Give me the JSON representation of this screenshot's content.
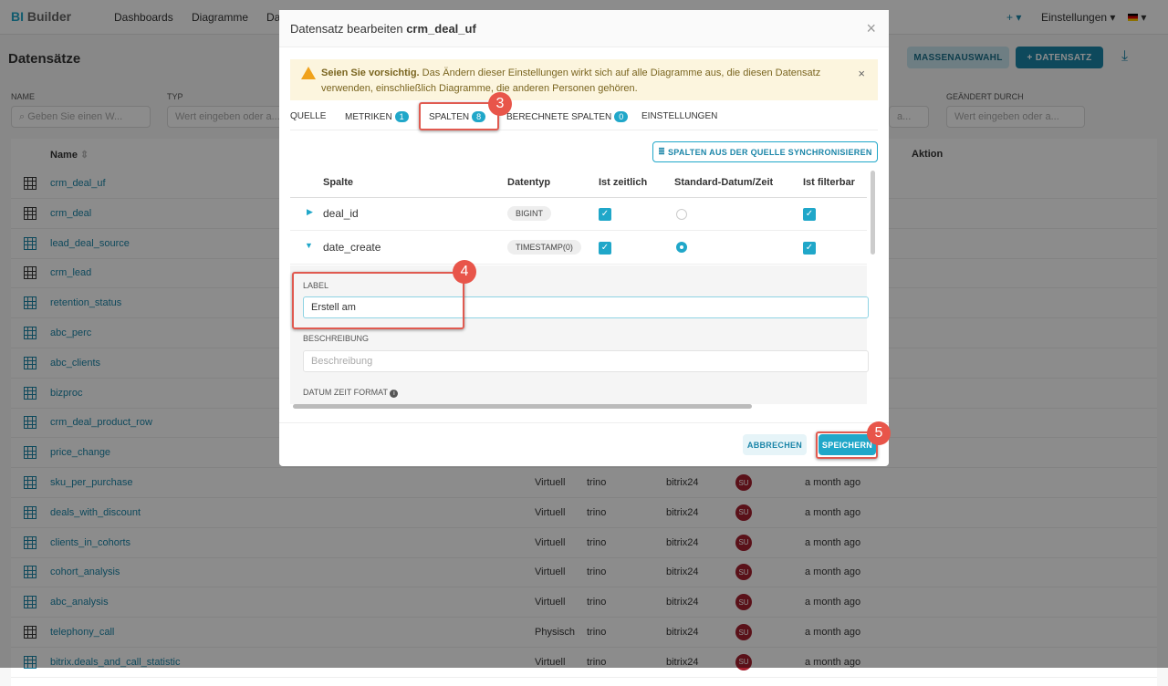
{
  "app": {
    "logo_prefix": "BI",
    "logo_suffix": "Builder"
  },
  "nav": {
    "items": [
      "Dashboards",
      "Diagramme",
      "Da"
    ],
    "plus": "+ ▾",
    "settings": "Einstellungen ▾",
    "lang": "▾"
  },
  "page": {
    "title": "Datensätze",
    "bulk_label": "MASSENAUSWAHL",
    "add_label": "+ DATENSATZ"
  },
  "filters": {
    "name_label": "NAME",
    "name_placeholder": "Geben Sie einen W...",
    "type_label": "TYP",
    "type_placeholder": "Wert eingeben oder a...",
    "changed_label": "GEÄNDERT DURCH",
    "changed_placeholder": "Wert eingeben oder a...",
    "other_placeholder": "a..."
  },
  "table": {
    "col_name": "Name",
    "col_action": "Aktion",
    "rows": [
      {
        "name": "crm_deal_uf",
        "kind": "p"
      },
      {
        "name": "crm_deal",
        "kind": "p"
      },
      {
        "name": "lead_deal_source",
        "kind": "v"
      },
      {
        "name": "crm_lead",
        "kind": "p"
      },
      {
        "name": "retention_status",
        "kind": "v"
      },
      {
        "name": "abc_perc",
        "kind": "v"
      },
      {
        "name": "abc_clients",
        "kind": "v"
      },
      {
        "name": "bizproc",
        "kind": "v"
      },
      {
        "name": "crm_deal_product_row",
        "kind": "v"
      },
      {
        "name": "price_change",
        "kind": "v"
      },
      {
        "name": "sku_per_purchase",
        "kind": "v",
        "type": "Virtuell",
        "db": "trino",
        "schema": "bitrix24",
        "owner": "SU",
        "changed": "a month ago"
      },
      {
        "name": "deals_with_discount",
        "kind": "v",
        "type": "Virtuell",
        "db": "trino",
        "schema": "bitrix24",
        "owner": "SU",
        "changed": "a month ago"
      },
      {
        "name": "clients_in_cohorts",
        "kind": "v",
        "type": "Virtuell",
        "db": "trino",
        "schema": "bitrix24",
        "owner": "SU",
        "changed": "a month ago"
      },
      {
        "name": "cohort_analysis",
        "kind": "v",
        "type": "Virtuell",
        "db": "trino",
        "schema": "bitrix24",
        "owner": "SU",
        "changed": "a month ago"
      },
      {
        "name": "abc_analysis",
        "kind": "v",
        "type": "Virtuell",
        "db": "trino",
        "schema": "bitrix24",
        "owner": "SU",
        "changed": "a month ago"
      },
      {
        "name": "telephony_call",
        "kind": "p",
        "type": "Physisch",
        "db": "trino",
        "schema": "bitrix24",
        "owner": "SU",
        "changed": "a month ago"
      },
      {
        "name": "bitrix.deals_and_call_statistic",
        "kind": "v",
        "type": "Virtuell",
        "db": "trino",
        "schema": "bitrix24",
        "owner": "SU",
        "changed": "a month ago"
      }
    ]
  },
  "modal": {
    "title_prefix": "Datensatz bearbeiten ",
    "title_name": "crm_deal_uf",
    "alert_bold": "Seien Sie vorsichtig.",
    "alert_text": " Das Ändern dieser Einstellungen wirkt sich auf alle Diagramme aus, die diesen Datensatz verwenden, einschließlich Diagramme, die anderen Personen gehören.",
    "tabs": [
      {
        "label": "QUELLE"
      },
      {
        "label": "METRIKEN",
        "count": "1"
      },
      {
        "label": "SPALTEN",
        "count": "8"
      },
      {
        "label": "BERECHNETE SPALTEN",
        "count": "0"
      },
      {
        "label": "EINSTELLUNGEN"
      }
    ],
    "sync_label": "SPALTEN AUS DER QUELLE SYNCHRONISIEREN",
    "columns": [
      "Spalte",
      "Datentyp",
      "Ist zeitlich",
      "Standard-Datum/Zeit",
      "Ist filterbar"
    ],
    "rows": [
      {
        "name": "deal_id",
        "type": "BIGINT"
      },
      {
        "name": "date_create",
        "type": "TIMESTAMP(0)"
      }
    ],
    "label_label": "LABEL",
    "label_value": "Erstell am",
    "desc_label": "BESCHREIBUNG",
    "desc_placeholder": "Beschreibung",
    "format_label": "DATUM ZEIT FORMAT",
    "cancel": "ABBRECHEN",
    "save": "SPEICHERN"
  },
  "annotations": [
    "3",
    "4",
    "5"
  ],
  "colors": {
    "accent": "#20a7c9",
    "annotation": "#e8554a"
  }
}
